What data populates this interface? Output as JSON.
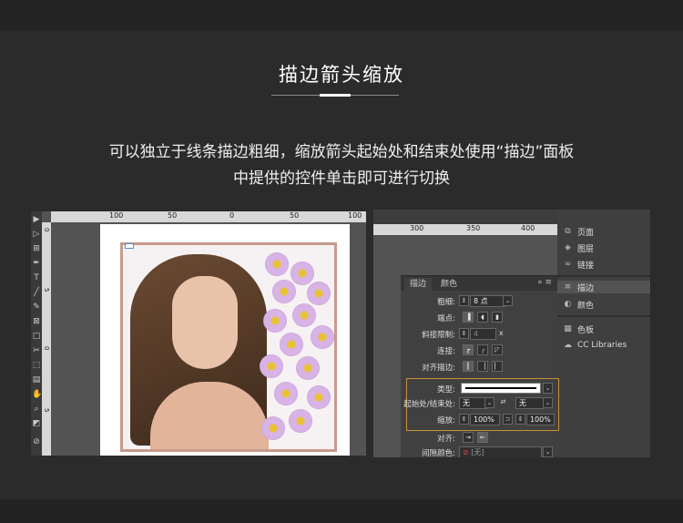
{
  "heading": {
    "title": "描边箭头缩放",
    "line1": "可以独立于线条描边粗细，缩放箭头起始处和结束处使用“描边”面板",
    "line2": "中提供的控件单击即可进行切换"
  },
  "left_ruler": {
    "ticks": [
      "100",
      "50",
      "0",
      "50",
      "100"
    ],
    "vticks": [
      "0",
      "5",
      "0",
      "5"
    ]
  },
  "right_ruler": {
    "ticks": [
      "300",
      "350",
      "400"
    ]
  },
  "side_panel": {
    "items": [
      {
        "label": "页面",
        "icon": "pages-icon"
      },
      {
        "label": "图层",
        "icon": "layers-icon"
      },
      {
        "label": "链接",
        "icon": "links-icon"
      },
      {
        "label": "描边",
        "icon": "stroke-icon",
        "active": true
      },
      {
        "label": "颜色",
        "icon": "color-icon"
      },
      {
        "label": "色板",
        "icon": "swatches-icon"
      },
      {
        "label": "CC Libraries",
        "icon": "cc-libraries-icon"
      }
    ]
  },
  "stroke_panel": {
    "tab_stroke": "描边",
    "tab_color": "颜色",
    "menu": "»  ≡",
    "weight_label": "粗细:",
    "weight_value": "8 点",
    "cap_label": "端点:",
    "miter_label": "斜接限制:",
    "miter_value": "4",
    "miter_unit": "x",
    "join_label": "连接:",
    "align_label": "对齐描边:",
    "type_label": "类型:",
    "start_end_label": "起始处/结束处:",
    "start_value": "无",
    "end_value": "无",
    "scale_label": "缩放:",
    "scale_start": "100%",
    "scale_end": "100%",
    "align2_label": "对齐:",
    "gap_color_label": "间隙颜色:",
    "gap_color_value": "[无]"
  }
}
